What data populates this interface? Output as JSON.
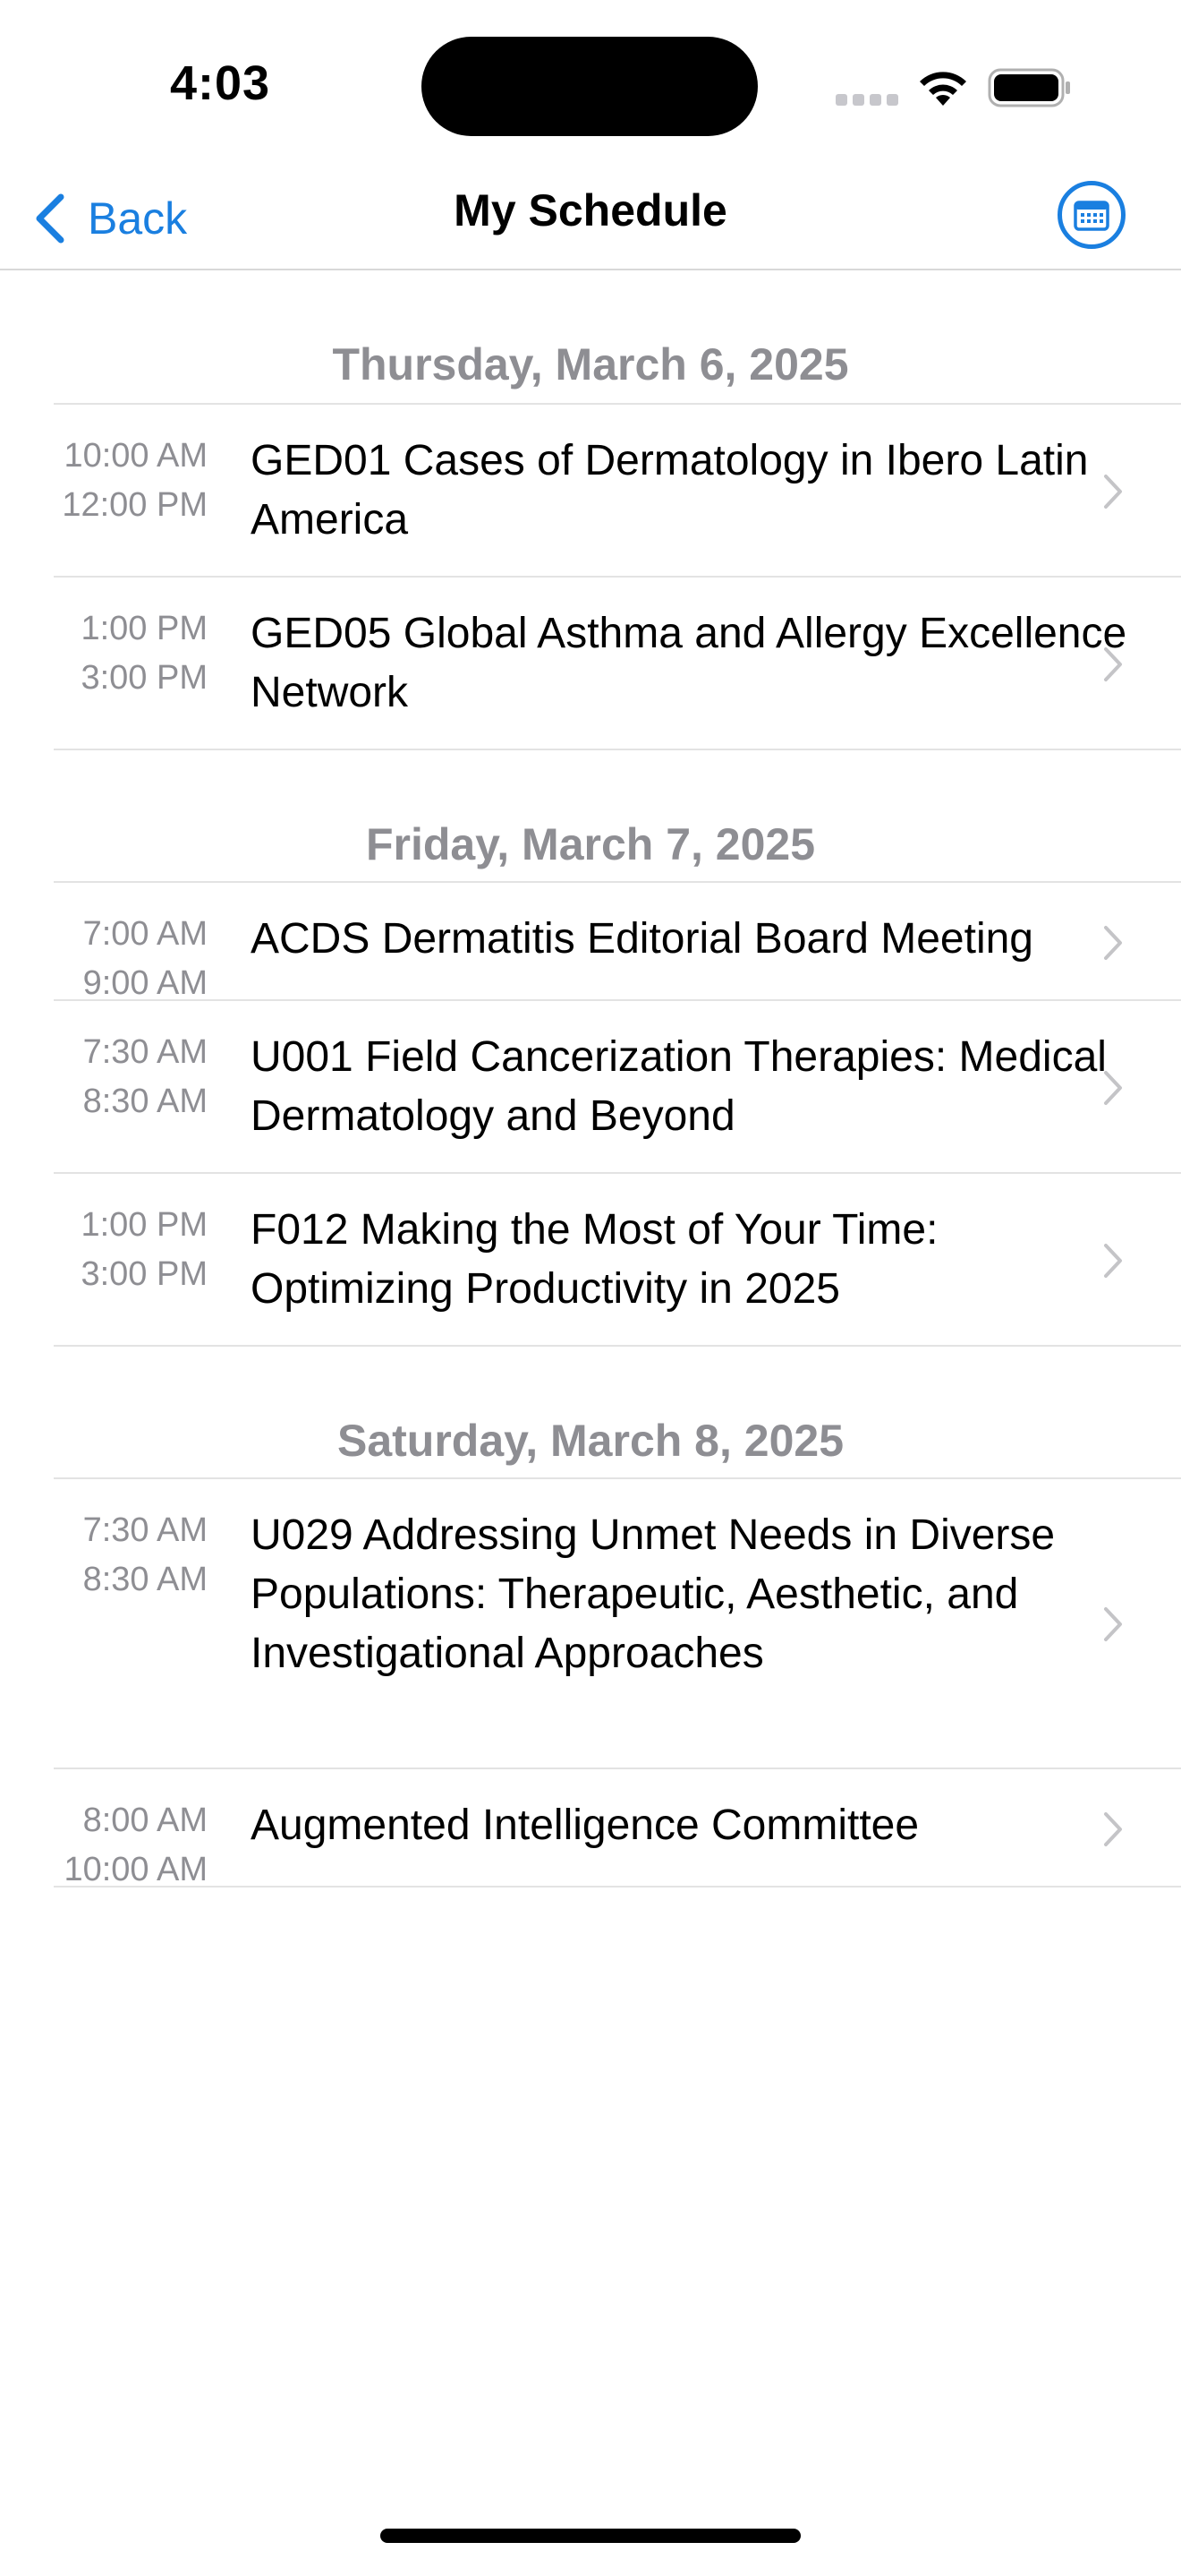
{
  "status_bar": {
    "time": "4:03"
  },
  "nav": {
    "back_label": "Back",
    "title": "My Schedule",
    "accent_color": "#1a7fe0"
  },
  "sections": [
    {
      "date": "Thursday, March 6, 2025",
      "sessions": [
        {
          "start": "10:00 AM",
          "end": "12:00 PM",
          "title": "GED01 Cases of Dermatology in Ibero Latin America"
        },
        {
          "start": "1:00 PM",
          "end": "3:00 PM",
          "title": "GED05 Global Asthma and Allergy Excellence Network"
        }
      ]
    },
    {
      "date": "Friday, March 7, 2025",
      "sessions": [
        {
          "start": "7:00 AM",
          "end": "9:00 AM",
          "title": "ACDS Dermatitis Editorial Board Meeting"
        },
        {
          "start": "7:30 AM",
          "end": "8:30 AM",
          "title": "U001 Field Cancerization Therapies: Medical Dermatology and Beyond"
        },
        {
          "start": "1:00 PM",
          "end": "3:00 PM",
          "title": "F012 Making the Most of Your Time: Optimizing Productivity in 2025"
        }
      ]
    },
    {
      "date": "Saturday, March 8, 2025",
      "sessions": [
        {
          "start": "7:30 AM",
          "end": "8:30 AM",
          "title": "U029 Addressing Unmet Needs in Diverse Populations: Therapeutic, Aesthetic, and Investigational Approaches"
        },
        {
          "start": "8:00 AM",
          "end": "10:00 AM",
          "title": "Augmented Intelligence Committee"
        }
      ]
    }
  ]
}
